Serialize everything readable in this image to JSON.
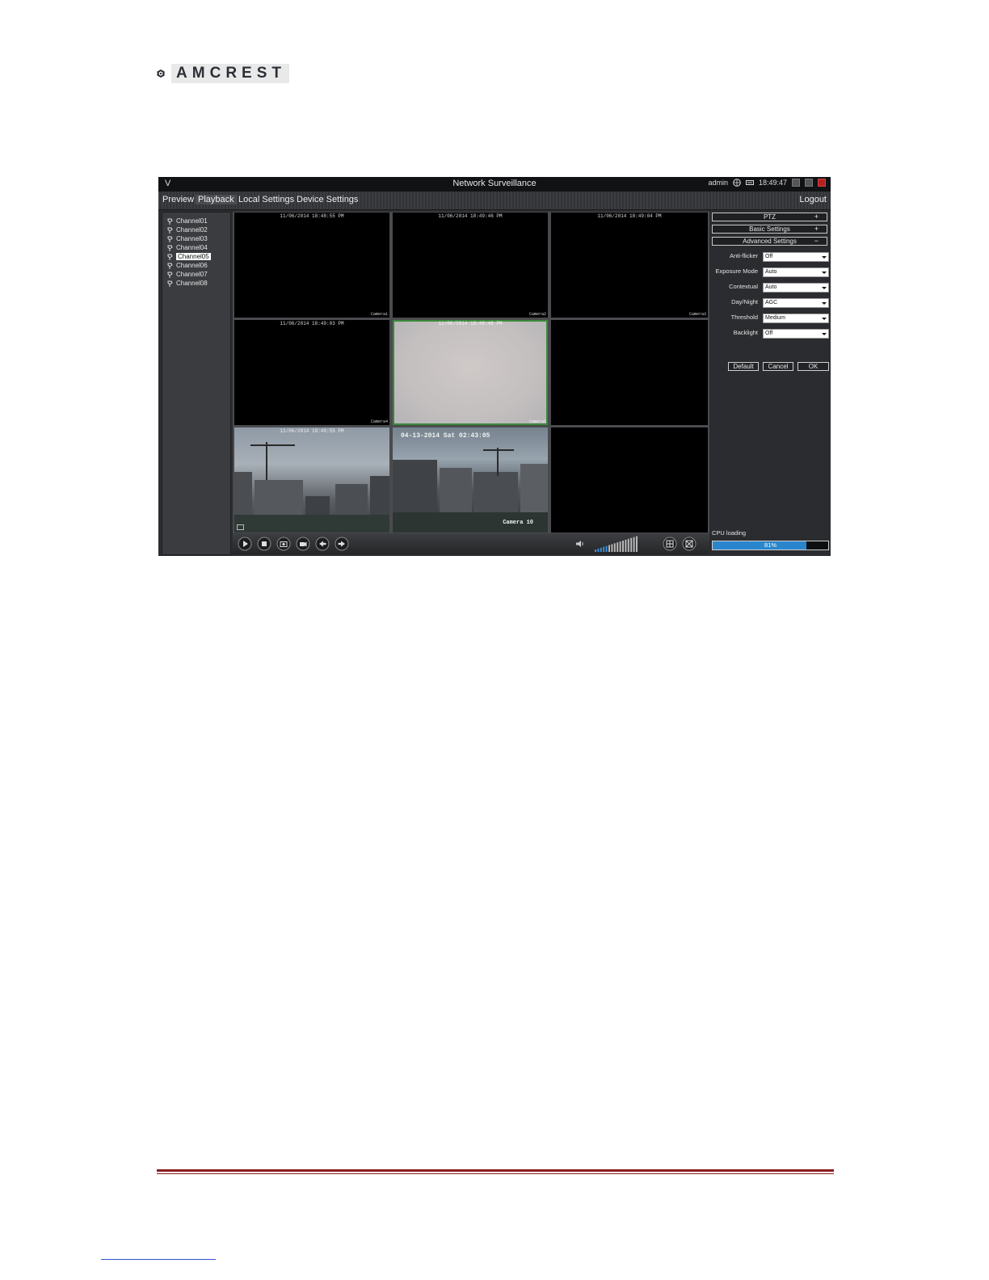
{
  "brand": {
    "name": "AMCREST"
  },
  "window": {
    "title": "Network Surveillance",
    "app_letter": "V",
    "user": "admin",
    "time": "18:49:47"
  },
  "menu": {
    "items": [
      {
        "label": "Preview"
      },
      {
        "label": "Playback"
      },
      {
        "label": "Local Settings"
      },
      {
        "label": "Device Settings"
      }
    ],
    "logout": "Logout"
  },
  "channels": [
    {
      "label": "Channel01"
    },
    {
      "label": "Channel02"
    },
    {
      "label": "Channel03"
    },
    {
      "label": "Channel04"
    },
    {
      "label": "Channel05",
      "selected": true
    },
    {
      "label": "Channel06"
    },
    {
      "label": "Channel07"
    },
    {
      "label": "Channel08"
    }
  ],
  "video": {
    "cells": [
      {
        "timestamp": "11/06/2014 18:48:55 PM",
        "camera": "Camera1"
      },
      {
        "timestamp": "11/06/2014 18:49:46 PM",
        "camera": "Camera2"
      },
      {
        "timestamp": "11/06/2014 18:49:04 PM",
        "camera": "Camera3"
      },
      {
        "timestamp": "11/06/2014 18:49:03 PM",
        "camera": "Camera4"
      },
      {
        "timestamp": "11/06/2014 18:49:48 PM",
        "camera": "Camera5"
      },
      {
        "timestamp": "",
        "camera": ""
      },
      {
        "timestamp": "11/06/2014 18:49:55 PM",
        "camera": ""
      },
      {
        "timestamp": "04-13-2014 Sat 02:43:05",
        "camera": "Camera 10"
      },
      {
        "timestamp": "",
        "camera": ""
      }
    ]
  },
  "toolbar": {
    "icons": [
      "play-icon",
      "stop-icon",
      "snapshot-icon",
      "record-icon",
      "prev-icon",
      "next-icon"
    ],
    "volume_icon": "speaker-icon",
    "volume_level": 0.3
  },
  "panel": {
    "ptz": {
      "label": "PTZ",
      "sign": "+"
    },
    "basic": {
      "label": "Basic Settings",
      "sign": "+"
    },
    "advanced": {
      "label": "Advanced Settings",
      "sign": "−"
    },
    "fields": [
      {
        "label": "Anti-flicker",
        "value": "Off"
      },
      {
        "label": "Exposure Mode",
        "value": "Auto"
      },
      {
        "label": "Contextual",
        "value": "Auto"
      },
      {
        "label": "Day/Night",
        "value": "AGC"
      },
      {
        "label": "Threshold",
        "value": "Medium"
      },
      {
        "label": "Backlight",
        "value": "Off"
      }
    ],
    "buttons": {
      "default": "Default",
      "cancel": "Cancel",
      "ok": "OK"
    },
    "cpu": {
      "label": "CPU loading",
      "percent": 81,
      "text": "81%"
    }
  },
  "colors": {
    "accent": "#2a86cc",
    "footer_rule": "#8b1c1c",
    "selected_border": "#3a8a3a"
  }
}
